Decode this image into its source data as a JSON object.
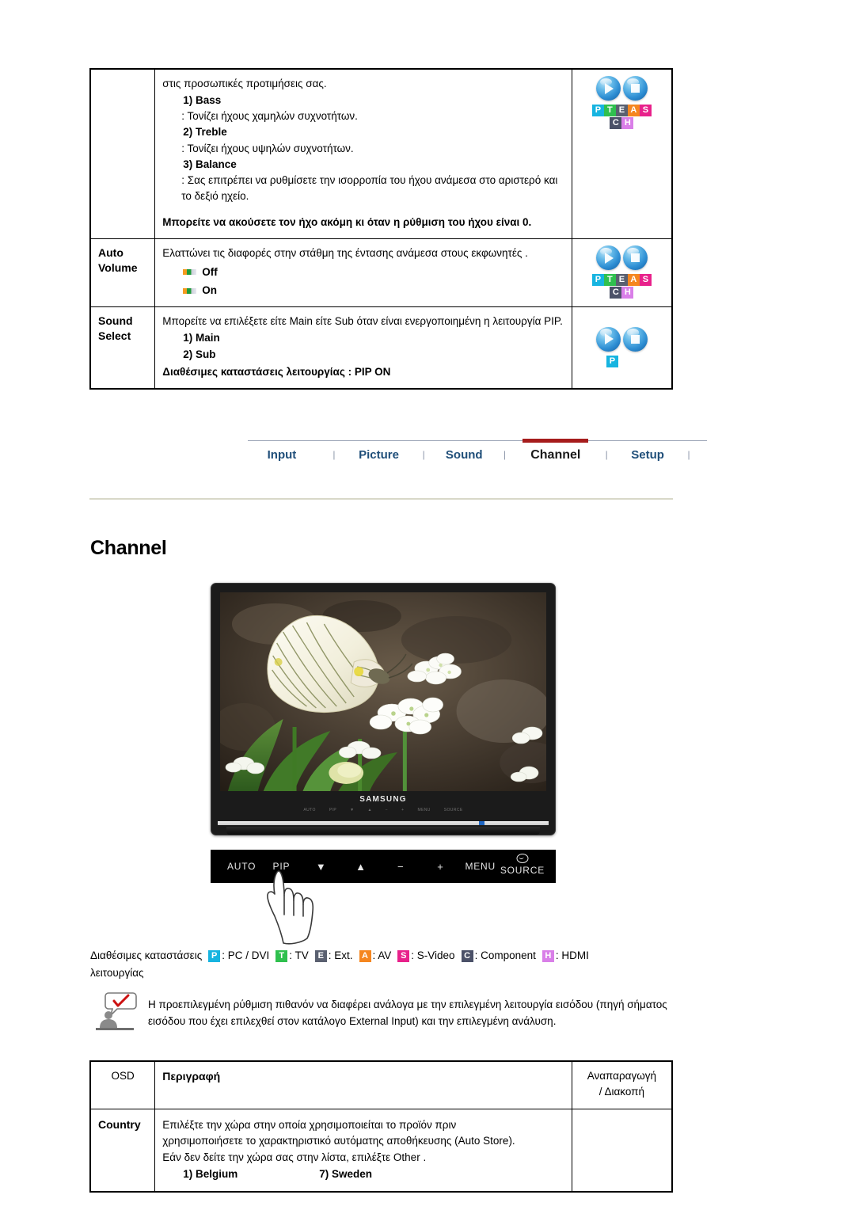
{
  "sound_table": {
    "rows": [
      {
        "label": "",
        "intro": "στις προσωπικές προτιμήσεις σας.",
        "items": [
          {
            "num": "1) Bass",
            "desc": ": Τονίζει ήχους χαμηλών συχνοτήτων."
          },
          {
            "num": "2) Treble",
            "desc": ": Τονίζει ήχους υψηλών συχνοτήτων."
          },
          {
            "num": "3) Balance",
            "desc": ": Σας επιτρέπει να ρυθμίσετε την ισορροπία του ήχου ανάμεσα στο αριστερό και το δεξιό ηχείο."
          }
        ],
        "note": "Μπορείτε να ακούσετε τον ήχο ακόμη κι όταν η ρύθμιση του ήχου είναι 0.",
        "badges": [
          "P",
          "T",
          "E",
          "A",
          "S",
          "C",
          "H"
        ]
      },
      {
        "label_line1": "Auto",
        "label_line2": "Volume",
        "intro": "Ελαττώνει τις διαφορές στην στάθμη της έντασης ανάμεσα στους εκφωνητές .",
        "bullets": [
          "Off",
          "On"
        ],
        "badges": [
          "P",
          "T",
          "E",
          "A",
          "S",
          "C",
          "H"
        ]
      },
      {
        "label_line1": "Sound",
        "label_line2": "Select",
        "intro": "Μπορείτε να επιλέξετε είτε Main είτε Sub όταν είναι ενεργοποιημένη η λειτουργία PIP.",
        "items": [
          {
            "num": "1) Main"
          },
          {
            "num": "2) Sub"
          }
        ],
        "note": "Διαθέσιμες καταστάσεις λειτουργίας : PIP ON",
        "badges": [
          "P"
        ]
      }
    ]
  },
  "tabs": {
    "items": [
      {
        "label": "Input",
        "active": false
      },
      {
        "label": "Picture",
        "active": false
      },
      {
        "label": "Sound",
        "active": false
      },
      {
        "label": "Channel",
        "active": true
      },
      {
        "label": "Setup",
        "active": false
      }
    ],
    "separator": "|"
  },
  "heading": "Channel",
  "monitor": {
    "brand": "SAMSUNG",
    "osd_marks": [
      "AUTO",
      "PIP",
      "▼",
      "▲",
      "−",
      "+",
      "MENU",
      "SOURCE"
    ],
    "controls": [
      "AUTO",
      "PIP",
      "▼",
      "▲",
      "−",
      "+",
      "MENU",
      "SOURCE"
    ],
    "source_icon": "source-icon"
  },
  "legend": {
    "lead_line1": "Διαθέσιμες καταστάσεις",
    "lead_line2": "λειτουργίας",
    "entries": [
      {
        "badge": "P",
        "text": ": PC / DVI"
      },
      {
        "badge": "T",
        "text": ": TV"
      },
      {
        "badge": "E",
        "text": ": Ext."
      },
      {
        "badge": "A",
        "text": ": AV"
      },
      {
        "badge": "S",
        "text": ": S-Video"
      },
      {
        "badge": "C",
        "text": ": Component"
      },
      {
        "badge": "H",
        "text": ": HDMI"
      }
    ]
  },
  "note": {
    "icon": "note-person-check-icon",
    "text": "Η προεπιλεγμένη ρύθμιση πιθανόν να διαφέρει ανάλογα με την επιλεγμένη λειτουργία εισόδου (πηγή σήματος εισόδου που έχει επιλεχθεί στον κατάλογο External Input) και την επιλεγμένη ανάλυση."
  },
  "osd_table": {
    "headers": {
      "osd": "OSD",
      "description": "Περιγραφή",
      "play_line1": "Αναπαραγωγή",
      "play_line2": "/ Διακοπή"
    },
    "rows": [
      {
        "osd": "Country",
        "desc_line1": "Επιλέξτε την χώρα στην οποία χρησιμοποιείται το προϊόν πριν",
        "desc_line2": "χρησιμοποιήσετε το χαρακτηριστικό αυτόματης αποθήκευσης (Auto Store).",
        "desc_line3": "Εάν δεν δείτε την χώρα σας στην λίστα, επιλέξτε Other .",
        "option_left": "1) Belgium",
        "option_right": "7) Sweden",
        "play": ""
      }
    ]
  },
  "colors": {
    "badge_P": "#17b4e0",
    "badge_T": "#2fc04e",
    "badge_E": "#5a6070",
    "badge_A": "#f5861f",
    "badge_S": "#e8218b",
    "badge_C": "#4b5168",
    "badge_H": "#d97fe8",
    "tab_link": "#1f4e79",
    "tab_active_bar": "#a61c1c",
    "rule": "#d8d8c8"
  }
}
